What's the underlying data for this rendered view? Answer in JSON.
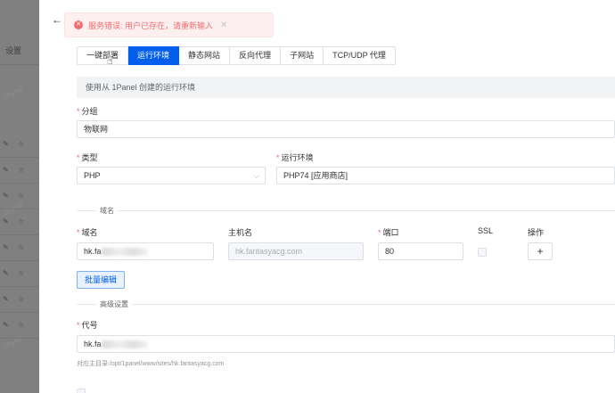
{
  "sidebar": {
    "settings_label": "设置",
    "watermark": "1Panel"
  },
  "drawer": {
    "error_message": "服务错误: 用户已存在，请重新输入",
    "tabs": [
      {
        "label": "一键部署"
      },
      {
        "label": "运行环境"
      },
      {
        "label": "静态网站"
      },
      {
        "label": "反向代理"
      },
      {
        "label": "子网站"
      },
      {
        "label": "TCP/UDP 代理"
      }
    ],
    "active_tab": "运行环境",
    "info_text": "使用从 1Panel 创建的运行环境",
    "group": {
      "label": "分组",
      "value": "物联网"
    },
    "type": {
      "label": "类型",
      "value": "PHP"
    },
    "runtime": {
      "label": "运行环境",
      "value": "PHP74 [应用商店]"
    },
    "domain_section": "域名",
    "domain_cols": {
      "domain": "域名",
      "host": "主机名",
      "port": "端口",
      "ssl": "SSL",
      "ops": "操作"
    },
    "domain_row": {
      "domain": "hk.fa",
      "host_placeholder": "hk.fantasyacg.com",
      "port": "80"
    },
    "add_symbol": "+",
    "batch_edit": "批量编辑",
    "advanced_section": "高级设置",
    "alias": {
      "label": "代号",
      "value": "hk.fa"
    },
    "root_hint": "对应主目录:/opt/1panel/www/sites/hk.fantasyacg.com"
  },
  "colors": {
    "primary": "#005eeb",
    "error": "#f56c6c",
    "required": "#f56c6c"
  },
  "icons": [
    "back-arrow-icon",
    "error-circle-icon",
    "close-icon",
    "chevron-down-icon",
    "plus-icon",
    "pointer-cursor-icon",
    "edit-icon",
    "star-icon"
  ]
}
